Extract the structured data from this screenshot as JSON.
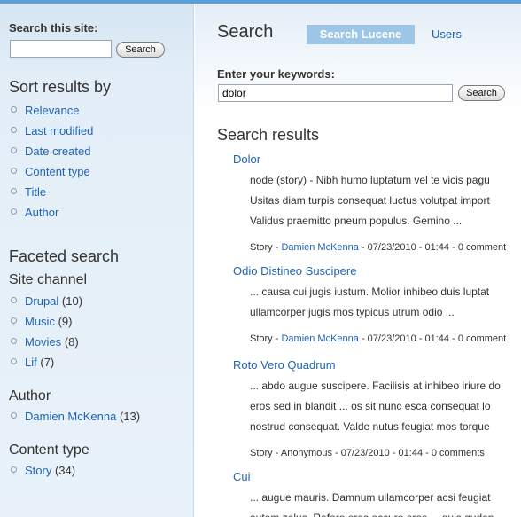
{
  "sidebar": {
    "search_label": "Search this site:",
    "search_value": "",
    "search_button": "Search",
    "sort_heading": "Sort results by",
    "sort_items": [
      "Relevance",
      "Last modified",
      "Date created",
      "Content type",
      "Title",
      "Author"
    ],
    "faceted_heading": "Faceted search",
    "site_channel_heading": "Site channel",
    "site_channel_items": [
      {
        "label": "Drupal",
        "count": "(10)"
      },
      {
        "label": "Music",
        "count": "(9)"
      },
      {
        "label": "Movies",
        "count": "(8)"
      },
      {
        "label": "Lif",
        "count": "(7)"
      }
    ],
    "author_heading": "Author",
    "author_items": [
      {
        "label": "Damien McKenna",
        "count": "(13)"
      }
    ],
    "content_type_heading": "Content type",
    "content_type_items": [
      {
        "label": "Story",
        "count": "(34)"
      }
    ]
  },
  "main": {
    "page_title": "Search",
    "tabs": [
      {
        "label": "Search Lucene",
        "active": true
      },
      {
        "label": "Users",
        "active": false
      }
    ],
    "keywords_label": "Enter your keywords:",
    "keywords_value": "dolor",
    "search_button": "Search",
    "results_heading": "Search results",
    "results": [
      {
        "title": "Dolor",
        "snippet": [
          "node (story) - Nibh humo luptatum vel te vicis pagu",
          "Usitas diam turpis consequat luctus volutpat import",
          "Validus praemitto pneum populus. Gemino ..."
        ],
        "meta_type": "Story",
        "meta_author": "Damien McKenna",
        "meta_rest": " - 07/23/2010 - 01:44 - 0 comment"
      },
      {
        "title": "Odio Distineo Suscipere",
        "snippet": [
          "... causa cui jugis iustum. Molior inhibeo duis luptat",
          "ullamcorper jugis mos typicus utrum odio ..."
        ],
        "meta_type": "Story",
        "meta_author": "Damien McKenna",
        "meta_rest": " - 07/23/2010 - 01:44 - 0 comment"
      },
      {
        "title": "Roto Vero Quadrum",
        "snippet": [
          "... abdo augue suscipere. Facilisis at inhibeo iriure do",
          "eros sed in blandit ... os sit nunc esca consequat lo",
          "nostrud consequat. Valde nutus feugiat mos torque"
        ],
        "meta_type": "Story",
        "meta_author": "Anonymous",
        "meta_rest": " - 07/23/2010 - 01:44 - 0 comments"
      },
      {
        "title": "Cui",
        "snippet": [
          "... augue mauris. Damnum ullamcorper acsi feugiat",
          "autem zelus. Refero eros occuro eros ... quis guden"
        ]
      }
    ]
  },
  "colors": {
    "link": "#1f63b5",
    "active_tab_bg": "#9cc5e6",
    "top_bar": "#5a9fd6"
  }
}
